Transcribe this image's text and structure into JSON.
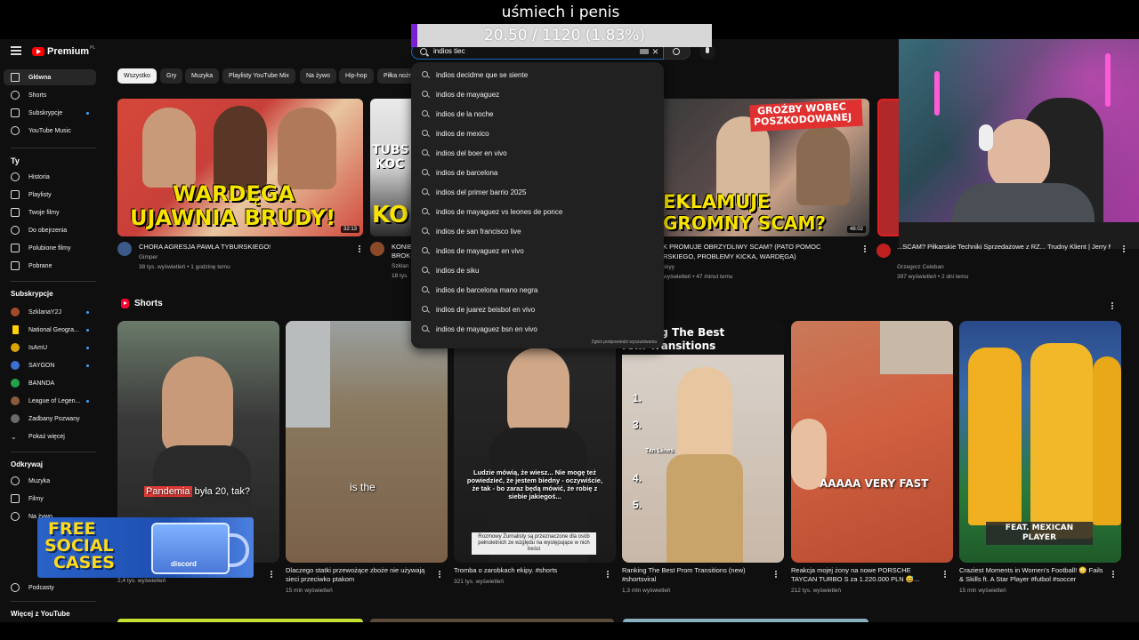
{
  "overlay": {
    "title": "uśmiech i penis",
    "counter": "20.50 / 1120 (1.83%)",
    "counter_fraction": 0.0183
  },
  "header": {
    "logo_text": "Premium",
    "logo_region": "PL",
    "search_value": "indios tiec",
    "icons": [
      "menu-icon",
      "youtube-logo",
      "keyboard-icon",
      "close-icon",
      "search-icon",
      "microphone-icon"
    ]
  },
  "sidebar": {
    "main": [
      {
        "label": "Główna",
        "icon": "home-icon",
        "active": true
      },
      {
        "label": "Shorts",
        "icon": "shorts-icon"
      },
      {
        "label": "Subskrypcje",
        "icon": "subscriptions-icon"
      },
      {
        "label": "YouTube Music",
        "icon": "music-icon"
      }
    ],
    "you_heading": "Ty",
    "you": [
      {
        "label": "Historia",
        "icon": "history-icon"
      },
      {
        "label": "Playlisty",
        "icon": "playlist-icon"
      },
      {
        "label": "Twoje filmy",
        "icon": "video-icon"
      },
      {
        "label": "Do obejrzenia",
        "icon": "clock-icon"
      },
      {
        "label": "Polubione filmy",
        "icon": "like-icon"
      },
      {
        "label": "Pobrane",
        "icon": "download-icon"
      }
    ],
    "subs_heading": "Subskrypcje",
    "subs": [
      {
        "label": "SzklanaY2J",
        "color": "#a34a2a"
      },
      {
        "label": "National Geogra...",
        "color": "#ffd200"
      },
      {
        "label": "IsAmU",
        "color": "#d9a400"
      },
      {
        "label": "SAYGON",
        "color": "#3b6fd1"
      },
      {
        "label": "BANNDA",
        "color": "#22a34a"
      },
      {
        "label": "League of Legen...",
        "color": "#8a5a3a"
      },
      {
        "label": "Zadbany Pozwany",
        "color": "#6a6a6a"
      },
      {
        "label": "Pokaż więcej",
        "icon": "chevron-down-icon"
      }
    ],
    "explore_heading": "Odkrywaj",
    "explore": [
      {
        "label": "Muzyka",
        "icon": "music-note-icon"
      },
      {
        "label": "Filmy",
        "icon": "film-icon"
      },
      {
        "label": "Na żywo",
        "icon": "live-icon"
      },
      {
        "label": "Podcasty",
        "icon": "podcast-icon"
      }
    ],
    "more_heading": "Więcej z YouTube"
  },
  "chips": [
    "Wszystko",
    "Gry",
    "Muzyka",
    "Playlisty YouTube Mix",
    "Na żywo",
    "Hip-hop",
    "Piłka nożn"
  ],
  "suggestions": [
    "indios decidme que se siente",
    "indios de mayaguez",
    "indios de la noche",
    "indios de mexico",
    "indios del boer en vivo",
    "indios de barcelona",
    "indios del primer barrio 2025",
    "indios de mayaguez vs leones de ponce",
    "indios de san francisco live",
    "indios de mayaguez en vivo",
    "indios de siku",
    "indios de barcelona mano negra",
    "indios de juarez beisbol en vivo",
    "indios de mayaguez bsn en vivo"
  ],
  "suggestions_report": "Zgłoś podpowiedzi wyszukiwania",
  "videos": [
    {
      "title": "CHORA AGRESJA PAWŁA TYBURSKIEGO!",
      "channel": "Gimper",
      "meta": "38 tys. wyświetleń • 1 godzinę temu",
      "duration": "32:13",
      "thumb_text_1": "WARDĘGA",
      "thumb_text_2": "UJAWNIA BRUDY!"
    },
    {
      "title": "KONIE",
      "title_line2": "BROK",
      "channel": "Szklan",
      "meta": "18 tys.",
      "thumb_text_1": "TUBS",
      "thumb_text_2": "KOC",
      "thumb_text_3": "KO"
    },
    {
      "title": "K PROMUJE OBRZYDLIWY SCAM? (PATO POMOC",
      "title_line2": "RSKIEGO, PROBLEMY KICKA, WARDĘGA)",
      "channel": "skyy",
      "meta": "wyświetleń • 47 minut temu",
      "duration": "48:02",
      "thumb_text_1": "GROŹBY WOBEC",
      "thumb_text_2": "POSZKODOWANEJ",
      "thumb_text_3": "EKLAMUJE",
      "thumb_text_4": "GROMNY SCAM?"
    },
    {
      "title": "...SCAM? Piłkarskie Techniki Sprzedażowe z RZ... Trudny Klient | Jerry Maguire",
      "channel": "Grzegorz Celeban",
      "meta": "397 wyświetleń • 2 dni temu"
    }
  ],
  "shorts_heading": "Shorts",
  "shorts": [
    {
      "title": "",
      "meta": "2,4 tys. wyświetleń",
      "caption_red": "Pandemia",
      "caption": " była 20, tak?"
    },
    {
      "title": "Dlaczego statki przewożące zboże nie używają sieci przeciwko ptakom",
      "meta": "15 mln wyświetleń",
      "caption": "is the"
    },
    {
      "title": "Tromba o zarobkach ekipy. #shorts",
      "meta": "321 tys. wyświetleń",
      "caption": "Ludzie mówią, że wiesz... Nie mogę też powiedzieć, że jestem biedny - oczywiście, że tak - bo zaraz będą mówić, że robię z siebie jakiegoś...",
      "note": "Rozmowy Żurnalisty są przeznaczone dla osób pełnoletnich ze względu na występujące w nich treści"
    },
    {
      "title": "Ranking The Best Prom Transitions (new) #shortsviral",
      "meta": "1,3 mln wyświetleń",
      "caption": "anking The Best",
      "caption2": "rom Transitions",
      "numbers": [
        "1.",
        "3.",
        "4.",
        "5."
      ],
      "tag": "Tan Lines"
    },
    {
      "title": "Reakcja mojej żony na nowe PORSCHE TAYCAN TURBO S za 1.220.000 PLN 😅...",
      "meta": "212 tys. wyświetleń",
      "caption": "AAAAA VERY FAST"
    },
    {
      "title": "Craziest Moments in Women's Football! 😳 Fails & Skills ft. A Star Player #futbol #soccer",
      "meta": "15 mln wyświetleń",
      "caption": "FEAT. MEXICAN PLAYER"
    }
  ],
  "ad": {
    "line1": "FREE",
    "line2": "SOCIAL",
    "line3": "CASES",
    "tag": "discord"
  }
}
